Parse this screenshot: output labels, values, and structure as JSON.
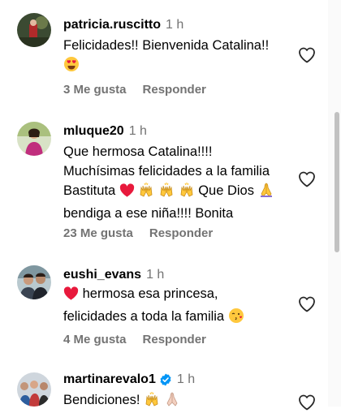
{
  "comments": [
    {
      "username": "patricia.ruscitto",
      "time": "1 h",
      "text": "Felicidades!! Bienvenida Catalina!!",
      "likes": "3 Me gusta",
      "reply": "Responder"
    },
    {
      "username": "mluque20",
      "time": "1 h",
      "line1": "Que hermosa Catalina!!!!",
      "line2": "Muchísimas felicidades a la familia",
      "line3a": "Bastituta",
      "line3b": "Que Dios",
      "line4": "bendiga a ese niña!!!! Bonita",
      "likes": "23 Me gusta",
      "reply": "Responder"
    },
    {
      "username": "eushi_evans",
      "time": "1 h",
      "line1": "hermosa esa princesa,",
      "line2": "felicidades a toda la familia",
      "likes": "4 Me gusta",
      "reply": "Responder"
    },
    {
      "username": "martinarevalo1",
      "time": "1 h",
      "text": "Bendiciones!"
    }
  ],
  "icons": {
    "like": "heart-outline",
    "verified": "verified-badge",
    "emojis": [
      "heart-eyes",
      "red-heart",
      "raising-hands",
      "folded-hands",
      "kiss-face"
    ]
  },
  "colors": {
    "muted": "#737373",
    "verified": "#0095f6",
    "heart_red": "#e8193c"
  }
}
